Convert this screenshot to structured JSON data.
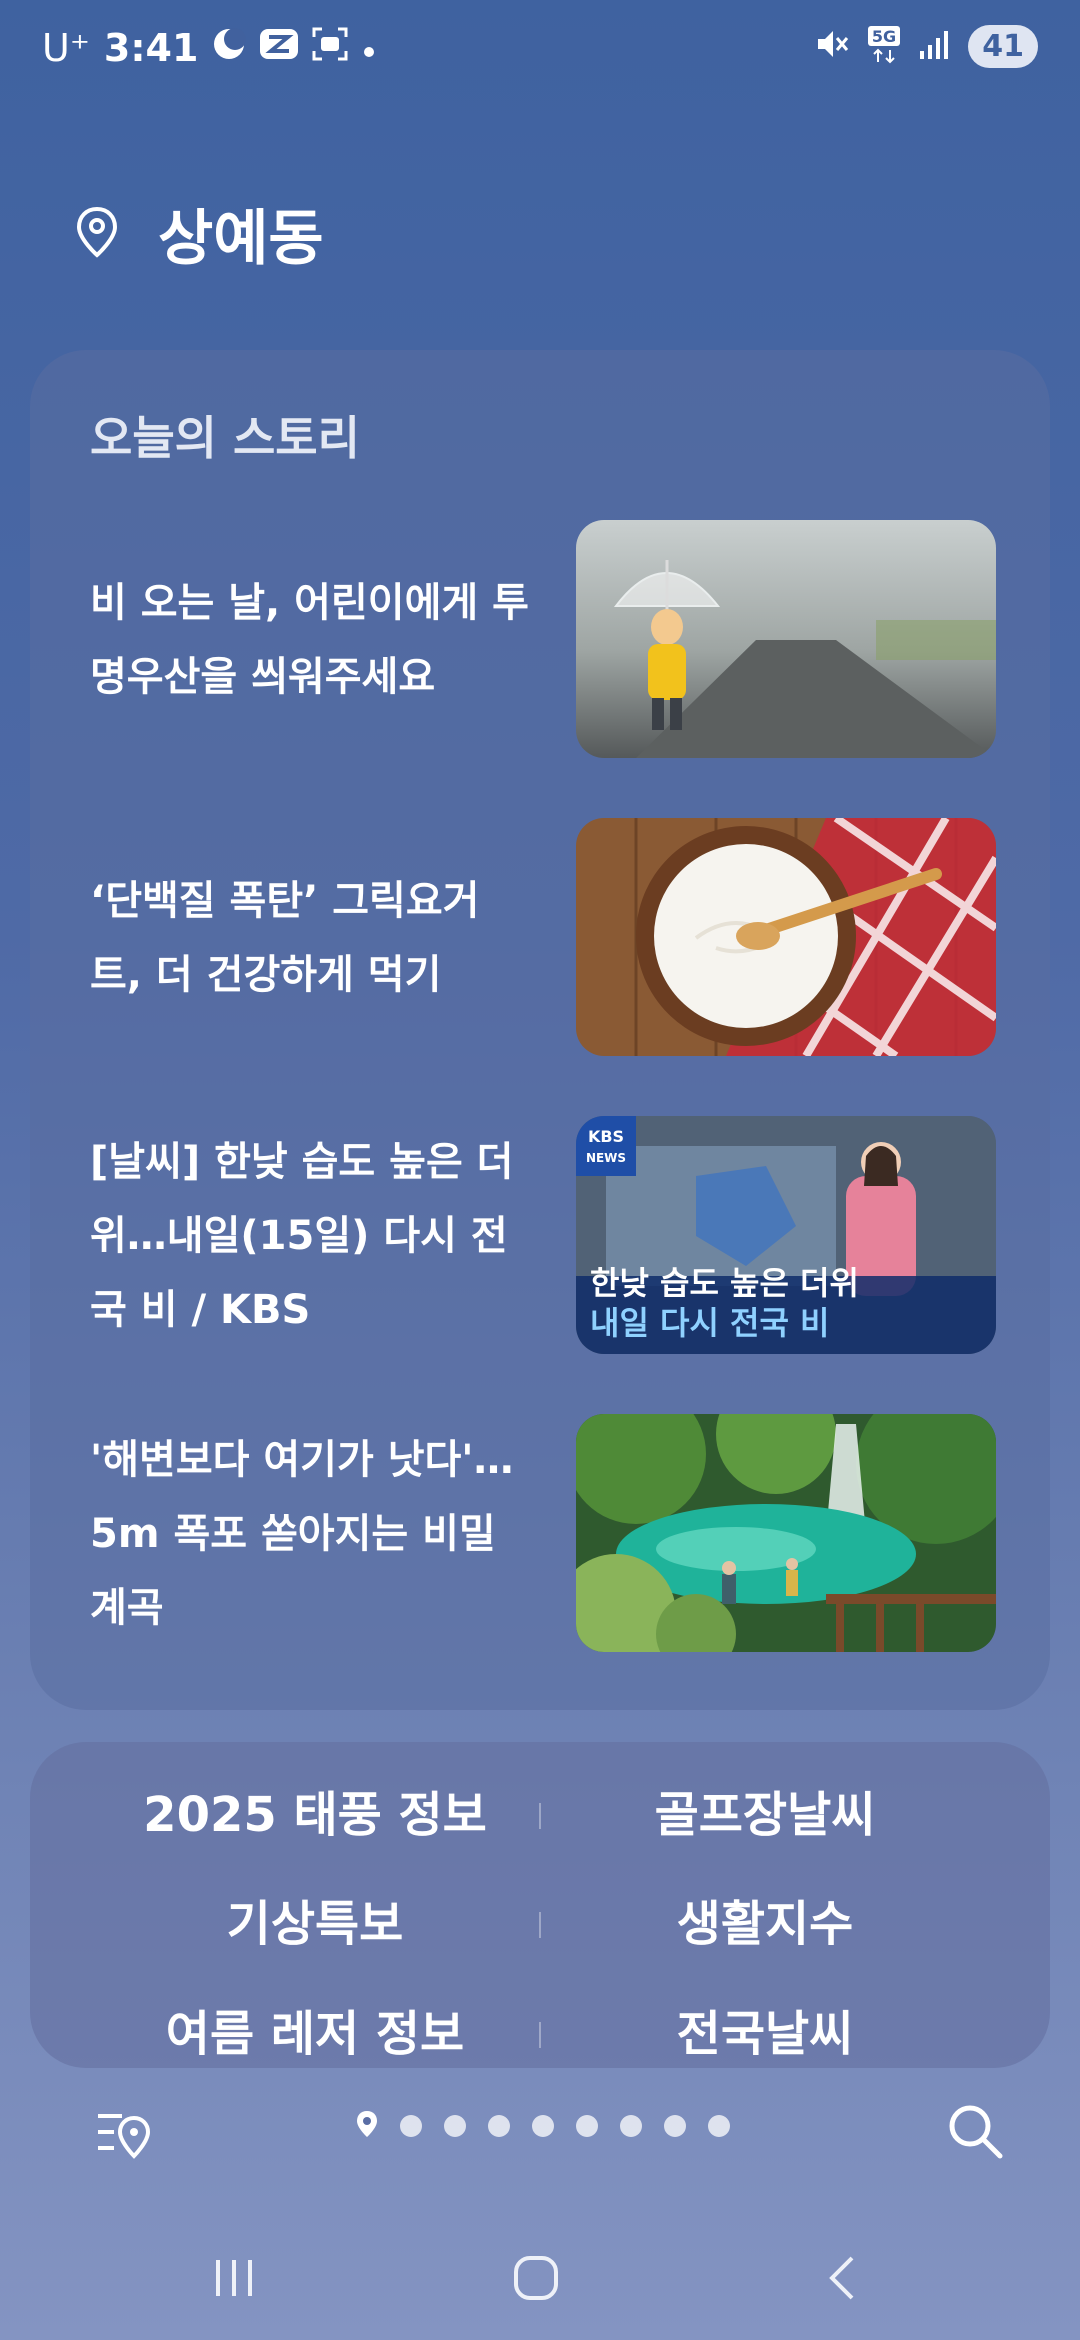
{
  "status_bar": {
    "carrier": "U⁺",
    "time": "3:41",
    "network": "5G",
    "battery": "41"
  },
  "location": {
    "name": "상예동",
    "icon": "location-pin-icon"
  },
  "stories": {
    "heading": "오늘의 스토리",
    "items": [
      {
        "title": "비 오는 날, 어린이에게 투명우산을 씌워주세요"
      },
      {
        "title": "‘단백질 폭탄’ 그릭요거트, 더 건강하게 먹기"
      },
      {
        "title": "[날씨] 한낮 습도 높은 더위…내일(15일) 다시 전국 비 / KBS",
        "thumb_labels": {
          "logo_top": "KBS",
          "logo_bottom": "NEWS",
          "line1": "한낮 습도 높은 더위",
          "line2": "내일 다시 전국 비"
        }
      },
      {
        "title": "'해변보다 여기가 낫다'… 5m 폭포 쏟아지는 비밀 계곡"
      }
    ]
  },
  "links": {
    "rows": [
      {
        "left": "2025 태풍 정보",
        "right": "골프장날씨"
      },
      {
        "left": "기상특보",
        "right": "생활지수"
      },
      {
        "left": "여름 레저 정보",
        "right": "전국날씨"
      }
    ]
  },
  "bottom_bar": {
    "page_count": 9,
    "current_page": 1
  },
  "colors": {
    "accent": "#3f62a0",
    "card": "#5a6ea0",
    "text": "#ffffff"
  }
}
